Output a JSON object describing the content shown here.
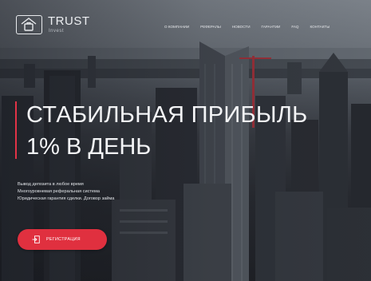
{
  "brand": {
    "name": "TRUST",
    "subtitle": "Invest",
    "logo_icon": "house-bag-icon"
  },
  "nav": {
    "items": [
      {
        "label": "О компании"
      },
      {
        "label": "Рефералы"
      },
      {
        "label": "Новости"
      },
      {
        "label": "Гарантии"
      },
      {
        "label": "FAQ"
      },
      {
        "label": "Контакты"
      }
    ]
  },
  "hero": {
    "title_line1": "СТАБИЛЬНАЯ ПРИБЫЛЬ",
    "title_line2": "1% В ДЕНЬ",
    "features": [
      "Вывод депозита в любое время",
      "Многоуровневая реферальная система",
      "Юридическая гарантия сделки. Договор займа"
    ],
    "cta_label": "Регистрация",
    "cta_icon": "login-arrow-icon",
    "accent_color": "#e0303f"
  }
}
